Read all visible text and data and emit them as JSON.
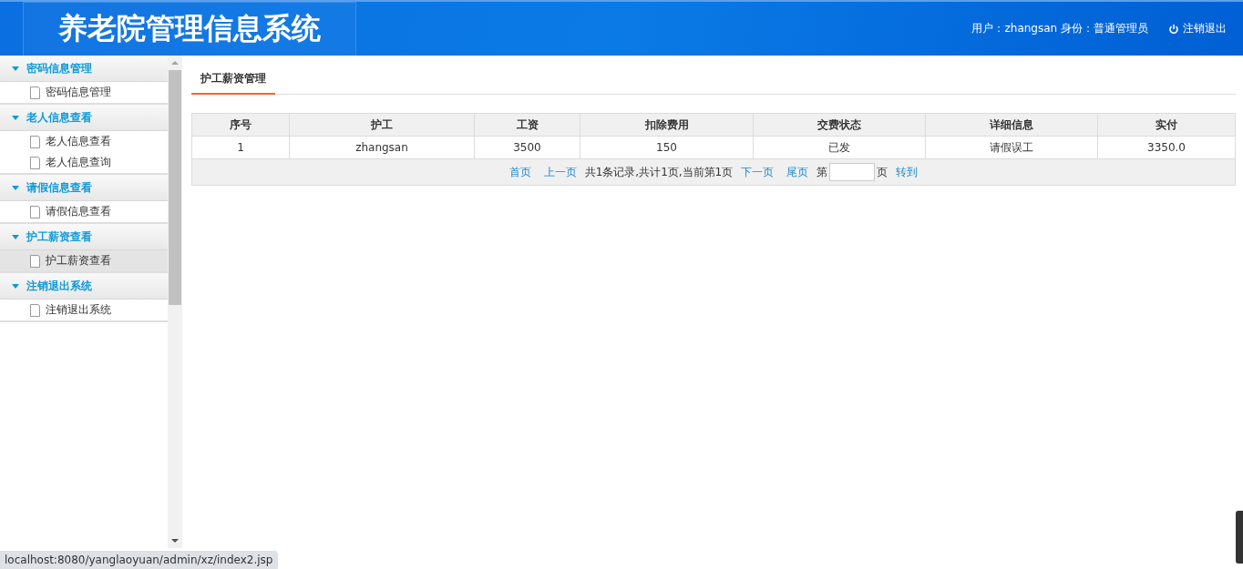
{
  "header": {
    "title": "养老院管理信息系统",
    "user_info": "用户：zhangsan 身份：普通管理员",
    "logout": "注销退出"
  },
  "sidebar": {
    "groups": [
      {
        "label": "密码信息管理",
        "expanded": true,
        "items": [
          {
            "label": "密码信息管理",
            "selected": false
          }
        ]
      },
      {
        "label": "老人信息查看",
        "expanded": true,
        "items": [
          {
            "label": "老人信息查看",
            "selected": false
          },
          {
            "label": "老人信息查询",
            "selected": false
          }
        ]
      },
      {
        "label": "请假信息查看",
        "expanded": true,
        "items": [
          {
            "label": "请假信息查看",
            "selected": false
          }
        ]
      },
      {
        "label": "护工薪资查看",
        "expanded": true,
        "items": [
          {
            "label": "护工薪资查看",
            "selected": true
          }
        ]
      },
      {
        "label": "注销退出系统",
        "expanded": true,
        "items": [
          {
            "label": "注销退出系统",
            "selected": false
          }
        ]
      }
    ]
  },
  "tabs": [
    {
      "label": "护工薪资管理",
      "selected": true
    }
  ],
  "table": {
    "columns": [
      "序号",
      "护工",
      "工资",
      "扣除费用",
      "交费状态",
      "详细信息",
      "实付"
    ],
    "rows": [
      [
        "1",
        "zhangsan",
        "3500",
        "150",
        "已发",
        "请假误工",
        "3350.0"
      ]
    ]
  },
  "pager": [
    {
      "kind": "link",
      "text": "首页"
    },
    {
      "kind": "link",
      "text": "上一页"
    },
    {
      "kind": "text",
      "text": "共1条记录,共计1页,当前第1页"
    },
    {
      "kind": "link",
      "text": "下一页"
    },
    {
      "kind": "link",
      "text": "尾页"
    },
    {
      "kind": "text",
      "text": "第"
    },
    {
      "kind": "input"
    },
    {
      "kind": "text",
      "text": "页"
    },
    {
      "kind": "link",
      "text": "转到"
    }
  ],
  "status_bar": "localhost:8080/yanglaoyuan/admin/xz/index2.jsp"
}
